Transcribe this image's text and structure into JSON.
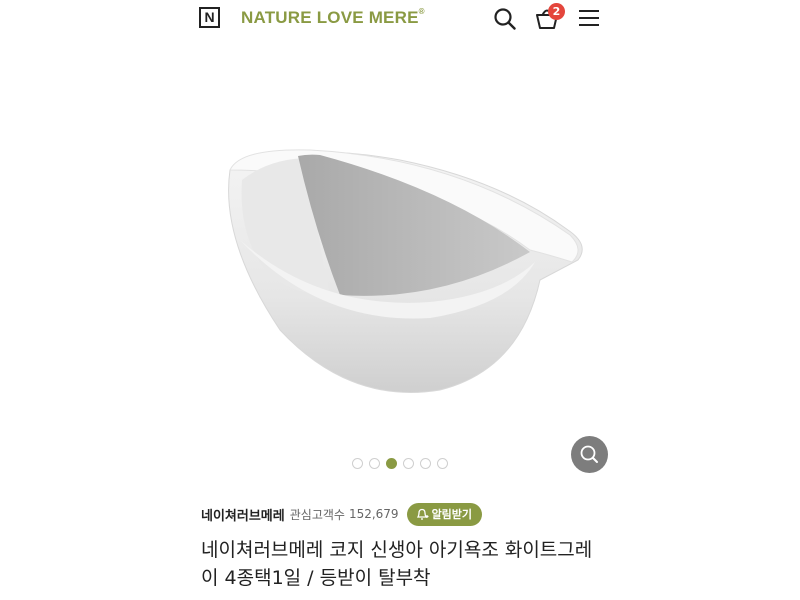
{
  "header": {
    "logo_letter": "N",
    "brand": "NATURE LOVE MERE",
    "brand_mark": "®",
    "cart_count": "2",
    "icons": [
      "logo-icon",
      "search-icon",
      "cart-icon",
      "menu-icon"
    ],
    "brand_color": "#8a9a43",
    "badge_color": "#e4463c"
  },
  "gallery": {
    "image_subject": "baby bathtub",
    "slide_total": 6,
    "active_slide": 3,
    "zoom_icon": "zoom-icon"
  },
  "product": {
    "seller": "네이쳐러브메레",
    "interest_label": "관심고객수",
    "interest_count": "152,679",
    "notify_label": "알림받기",
    "notify_icon": "bell-plus-icon",
    "title": "네이쳐러브메레 코지 신생아 아기욕조 화이트그레이 4종택1일 / 등받이 탈부착"
  }
}
